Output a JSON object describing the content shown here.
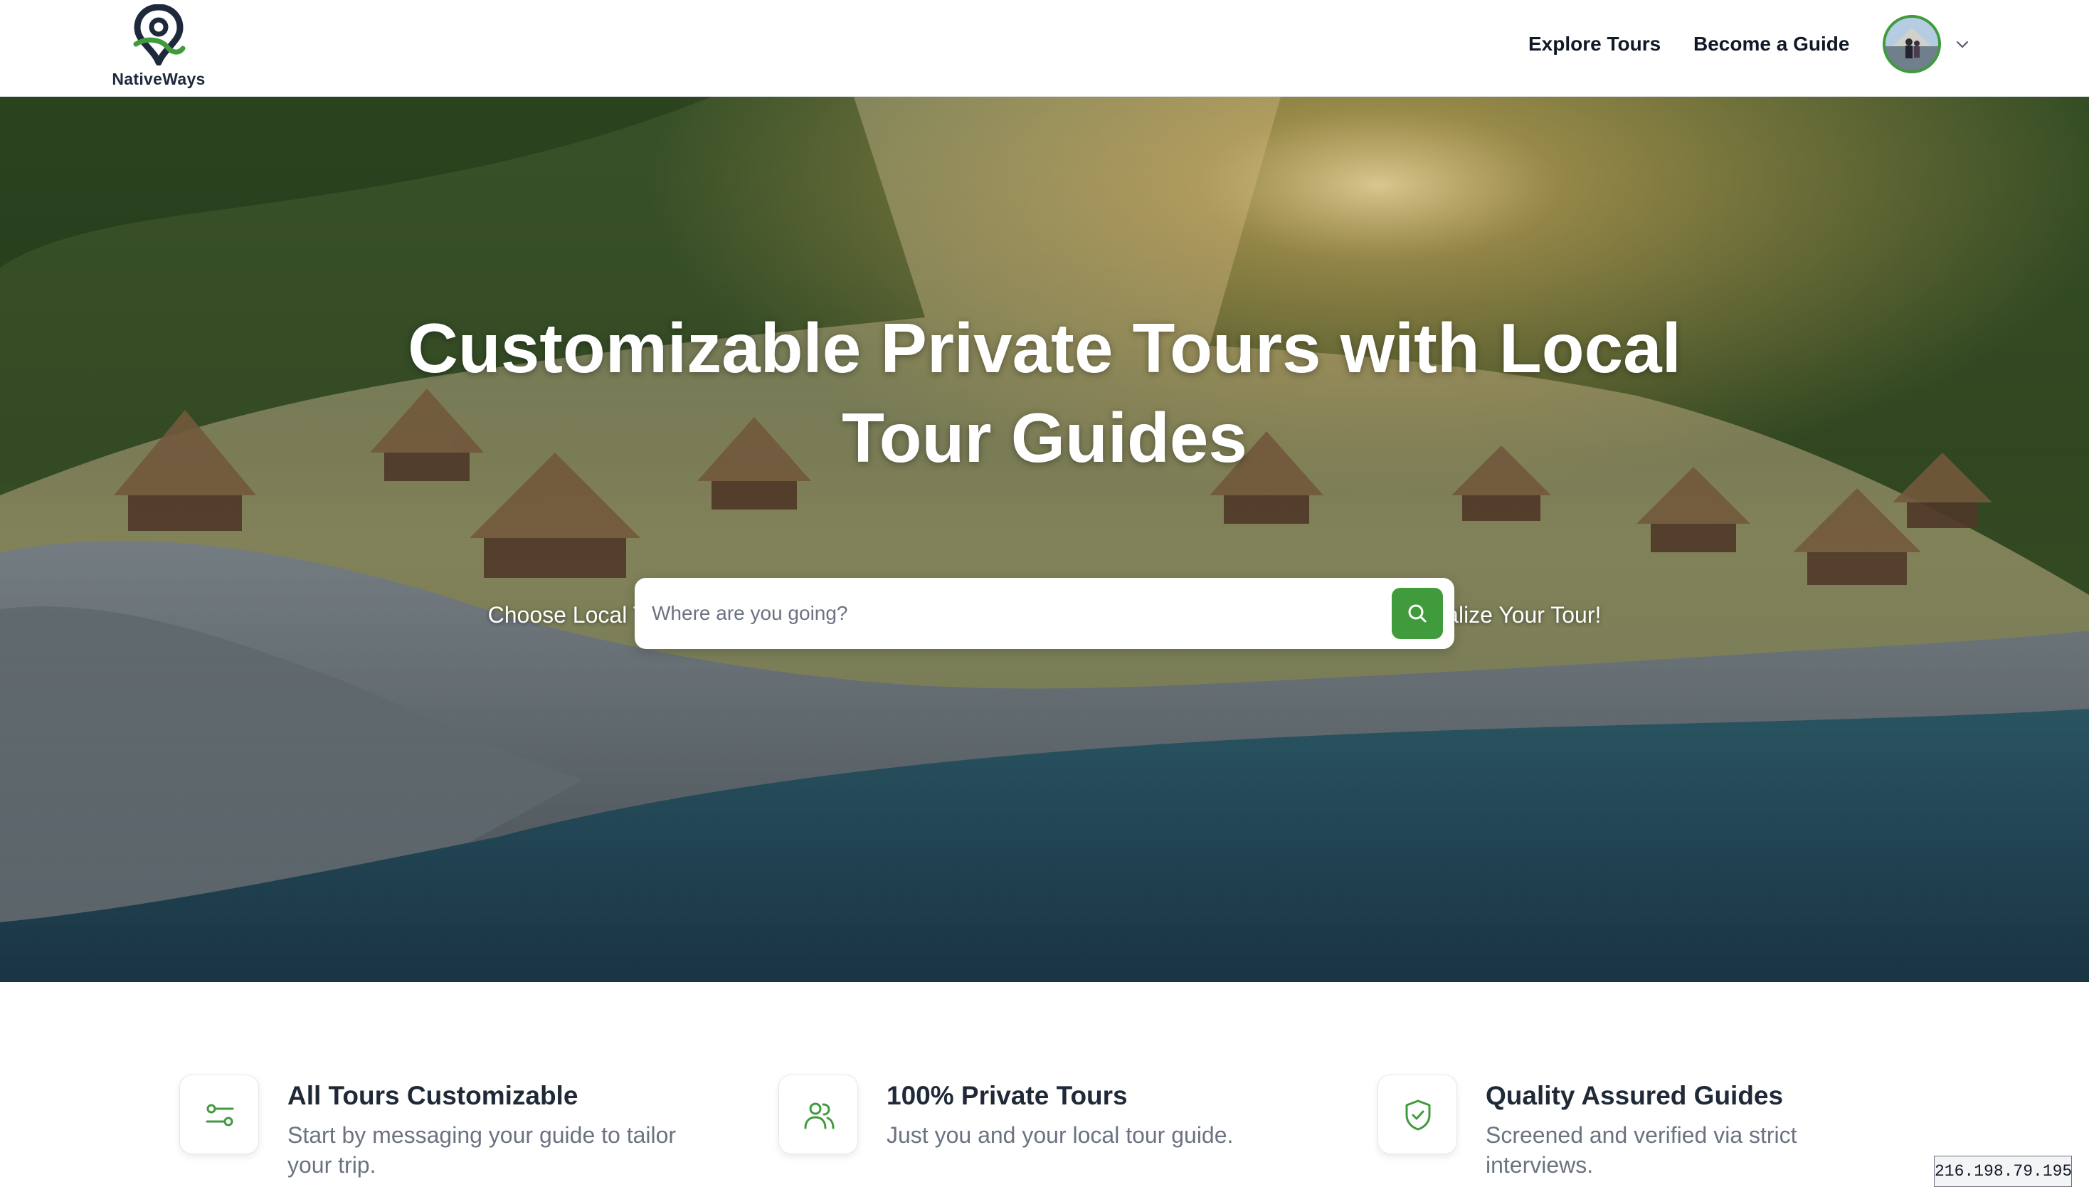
{
  "brand": {
    "name": "NativeWays",
    "primary_color": "#3f9b3c",
    "logo_dark_color": "#1e2a3b"
  },
  "nav": {
    "explore_label": "Explore Tours",
    "guide_label": "Become a Guide",
    "avatar_icon": "user-avatar",
    "menu_icon": "chevron-down-icon"
  },
  "hero": {
    "title": "Customizable Private Tours with Local Tour Guides",
    "subtitle": "Choose Local Tour Guides at the Destination of Your Choice. Simply Message Them To Personalize Your Tour!",
    "search": {
      "placeholder": "Where are you going?",
      "value": "",
      "button_icon": "search-icon"
    }
  },
  "features": [
    {
      "icon": "sliders-icon",
      "title": "All Tours Customizable",
      "description": "Start by messaging your guide to tailor your trip."
    },
    {
      "icon": "users-icon",
      "title": "100% Private Tours",
      "description": "Just you and your local tour guide."
    },
    {
      "icon": "shield-check-icon",
      "title": "Quality Assured Guides",
      "description": "Screened and verified via strict interviews."
    }
  ],
  "ip_address": "216.198.79.195"
}
